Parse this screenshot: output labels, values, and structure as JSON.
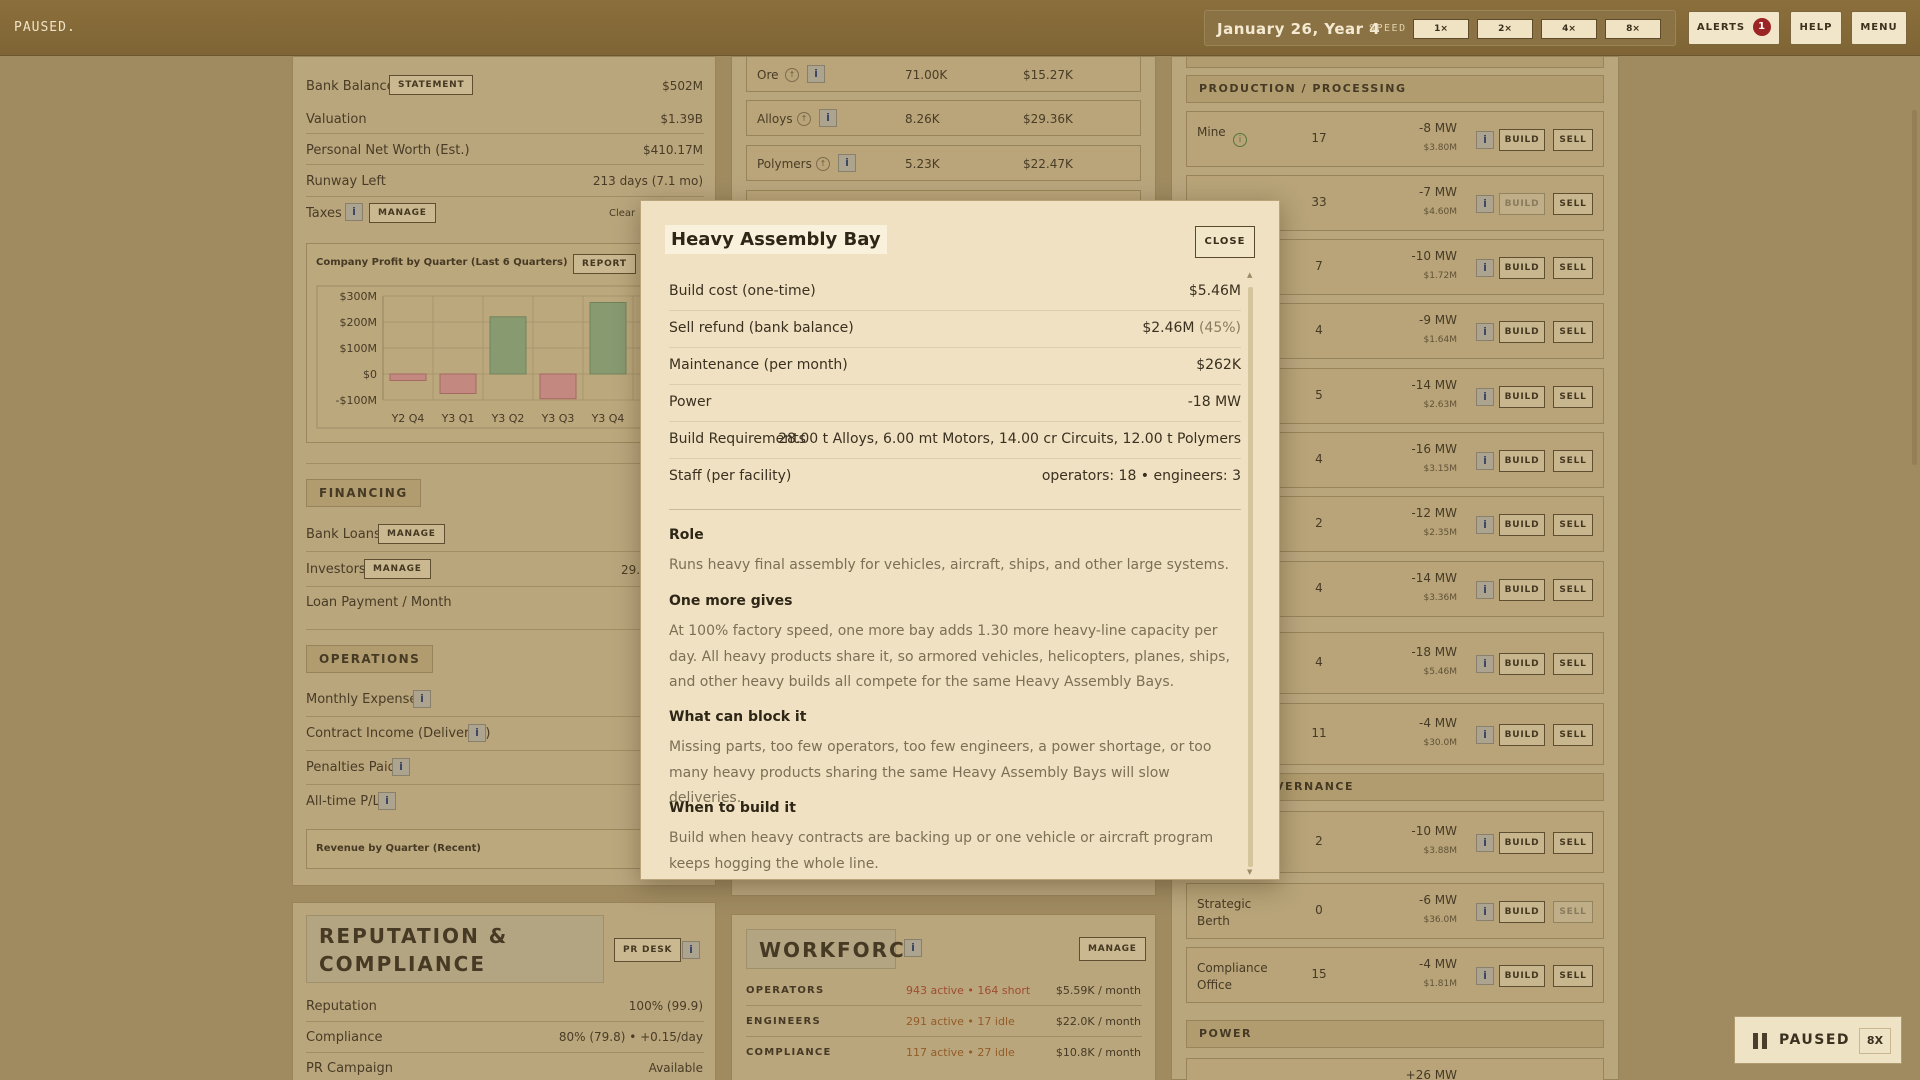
{
  "topbar": {
    "status": "PAUSED.",
    "date": "January 26, Year 4",
    "speed_label": "SPEED",
    "speeds": [
      "1×",
      "2×",
      "4×",
      "8×"
    ],
    "alerts_label": "ALERTS",
    "alerts_count": "1",
    "help_label": "HELP",
    "menu_label": "MENU"
  },
  "finance": {
    "bank_balance_label": "Bank Balance",
    "statement_label": "STATEMENT",
    "bank_balance": "$502M",
    "valuation_label": "Valuation",
    "valuation": "$1.39B",
    "net_worth_label": "Personal Net Worth (Est.)",
    "net_worth": "$410.17M",
    "runway_label": "Runway Left",
    "runway": "213 days (7.1 mo)",
    "taxes_label": "Taxes",
    "manage_label": "MANAGE",
    "taxes_value": "Clear",
    "chart_title": "Company Profit by Quarter (Last 6 Quarters)",
    "report_label": "REPORT"
  },
  "chart_data": {
    "type": "bar",
    "title": "Company Profit by Quarter (Last 6 Quarters)",
    "categories": [
      "Y2 Q4",
      "Y3 Q1",
      "Y3 Q2",
      "Y3 Q3",
      "Y3 Q4"
    ],
    "values": [
      -25,
      -75,
      220,
      -95,
      275
    ],
    "ylim": [
      -100,
      300
    ],
    "yticks": [
      "$300M",
      "$200M",
      "$100M",
      "$0",
      "-$100M"
    ],
    "colors": {
      "positive": "#8aa67c",
      "negative": "#d39290"
    }
  },
  "financing": {
    "title": "FINANCING",
    "loans_label": "Bank Loans",
    "manage_label": "MANAGE",
    "investors_label": "Investors",
    "investors_value": "29.",
    "loan_payment_label": "Loan Payment / Month"
  },
  "operations": {
    "title": "OPERATIONS",
    "items": [
      "Monthly Expenses",
      "Contract Income (Delivered)",
      "Penalties Paid",
      "All-time P/L"
    ],
    "revenue_chart_title": "Revenue by Quarter (Recent)"
  },
  "reputation": {
    "title": "REPUTATION & COMPLIANCE",
    "pr_desk_label": "PR DESK",
    "reputation_label": "Reputation",
    "reputation_value": "100% (99.9)",
    "compliance_label": "Compliance",
    "compliance_value": "80% (79.8) • +0.15/day",
    "pr_campaign_label": "PR Campaign",
    "pr_campaign_value": "Available"
  },
  "market": {
    "rows": [
      {
        "name": "Ore",
        "qty": "71.00K",
        "value": "$15.27K"
      },
      {
        "name": "Alloys",
        "qty": "8.26K",
        "value": "$29.36K"
      },
      {
        "name": "Polymers",
        "qty": "5.23K",
        "value": "$22.47K"
      }
    ]
  },
  "workforce": {
    "title": "WORKFORCE",
    "manage_label": "MANAGE",
    "rows": [
      {
        "role": "OPERATORS",
        "status": "943 active • 164 short",
        "cost": "$5.59K / month"
      },
      {
        "role": "ENGINEERS",
        "status": "291 active • 17 idle",
        "cost": "$22.0K / month"
      },
      {
        "role": "COMPLIANCE",
        "status": "117 active • 27 idle",
        "cost": "$10.8K / month"
      }
    ]
  },
  "facilities": {
    "production_title": "PRODUCTION / PROCESSING",
    "governance_title": "VERNANCE",
    "power_title": "POWER",
    "build_label": "BUILD",
    "sell_label": "SELL",
    "rows": [
      {
        "name": "Mine",
        "count": "17",
        "power": "-8 MW",
        "cost": "$3.80M"
      },
      {
        "name": "",
        "count": "33",
        "power": "-7 MW",
        "cost": "$4.60M"
      },
      {
        "name": "",
        "count": "7",
        "power": "-10 MW",
        "cost": "$1.72M"
      },
      {
        "name": "",
        "count": "4",
        "power": "-9 MW",
        "cost": "$1.64M"
      },
      {
        "name": "",
        "count": "5",
        "power": "-14 MW",
        "cost": "$2.63M"
      },
      {
        "name": "",
        "count": "4",
        "power": "-16 MW",
        "cost": "$3.15M"
      },
      {
        "name": "",
        "count": "2",
        "power": "-12 MW",
        "cost": "$2.35M"
      },
      {
        "name": "",
        "count": "4",
        "power": "-14 MW",
        "cost": "$3.36M"
      },
      {
        "name": "",
        "count": "4",
        "power": "-18 MW",
        "cost": "$5.46M"
      },
      {
        "name": "",
        "count": "11",
        "power": "-4 MW",
        "cost": "$30.0M"
      }
    ],
    "gov_rows": [
      {
        "name": "",
        "count": "2",
        "power": "-10 MW",
        "cost": "$3.88M"
      },
      {
        "name": "Strategic Berth",
        "count": "0",
        "power": "-6 MW",
        "cost": "$36.0M"
      },
      {
        "name": "Compliance Office",
        "count": "15",
        "power": "-4 MW",
        "cost": "$1.81M"
      }
    ],
    "power_row": {
      "power": "+26 MW"
    }
  },
  "modal": {
    "title": "Heavy Assembly Bay",
    "close_label": "CLOSE",
    "rows": [
      {
        "label": "Build cost (one-time)",
        "value": "$5.46M",
        "extra": ""
      },
      {
        "label": "Sell refund (bank balance)",
        "value": "$2.46M",
        "extra": "(45%)"
      },
      {
        "label": "Maintenance (per month)",
        "value": "$262K",
        "extra": ""
      },
      {
        "label": "Power",
        "value": "-18 MW",
        "extra": ""
      },
      {
        "label": "Build Requirements",
        "value": "28.00 t Alloys, 6.00 mt Motors, 14.00 cr Circuits, 12.00 t Polymers",
        "extra": ""
      },
      {
        "label": "Staff (per facility)",
        "value": "operators: 18 • engineers: 3",
        "extra": ""
      }
    ],
    "role_head": "Role",
    "role_text": "Runs heavy final assembly for vehicles, aircraft, ships, and other large systems.",
    "gives_head": "One more gives",
    "gives_text": "At 100% factory speed, one more bay adds 1.30 more heavy-line capacity per day. All heavy products share it, so armored vehicles, helicopters, planes, ships, and other heavy builds all compete for the same Heavy Assembly Bays.",
    "block_head": "What can block it",
    "block_text": "Missing parts, too few operators, too few engineers, a power shortage, or too many heavy products sharing the same Heavy Assembly Bays will slow deliveries.",
    "when_head": "When to build it",
    "when_text": "Build when heavy contracts are backing up or one vehicle or aircraft program keeps hogging the whole line."
  },
  "status_pill": {
    "label": "PAUSED",
    "speed": "8X"
  }
}
